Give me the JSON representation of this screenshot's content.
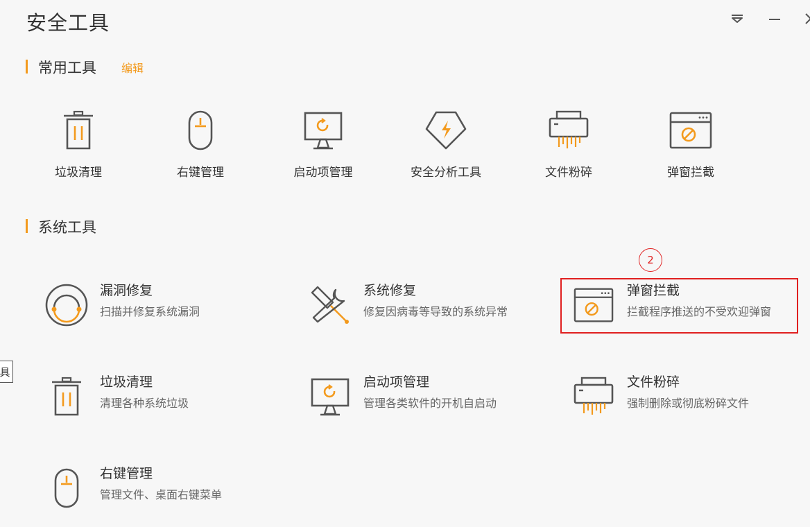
{
  "window": {
    "title": "安全工具",
    "controls": [
      "dropdown-icon",
      "minimize-icon",
      "close-icon"
    ]
  },
  "common": {
    "title": "常用工具",
    "edit": "编辑",
    "items": [
      {
        "label": "垃圾清理",
        "icon": "trash-icon"
      },
      {
        "label": "右键管理",
        "icon": "mouse-icon"
      },
      {
        "label": "启动项管理",
        "icon": "monitor-startup-icon"
      },
      {
        "label": "安全分析工具",
        "icon": "shield-bolt-icon"
      },
      {
        "label": "文件粉碎",
        "icon": "shredder-icon"
      },
      {
        "label": "弹窗拦截",
        "icon": "popup-block-icon"
      }
    ]
  },
  "system": {
    "title": "系统工具",
    "items": [
      {
        "name": "漏洞修复",
        "desc": "扫描并修复系统漏洞",
        "icon": "vulnerability-fix-icon"
      },
      {
        "name": "系统修复",
        "desc": "修复因病毒等导致的系统异常",
        "icon": "wrench-screwdriver-icon"
      },
      {
        "name": "弹窗拦截",
        "desc": "拦截程序推送的不受欢迎弹窗",
        "icon": "popup-block-icon"
      },
      {
        "name": "垃圾清理",
        "desc": "清理各种系统垃圾",
        "icon": "trash-icon"
      },
      {
        "name": "启动项管理",
        "desc": "管理各类软件的开机自启动",
        "icon": "monitor-startup-icon"
      },
      {
        "name": "文件粉碎",
        "desc": "强制删除或彻底粉碎文件",
        "icon": "shredder-icon"
      },
      {
        "name": "右键管理",
        "desc": "管理文件、桌面右键菜单",
        "icon": "mouse-icon"
      }
    ]
  },
  "annotation": {
    "step": "2"
  },
  "edge_tab": {
    "text": "具"
  },
  "colors": {
    "accent": "#f39a1d",
    "highlight": "#e02020",
    "icon": "#555555"
  }
}
